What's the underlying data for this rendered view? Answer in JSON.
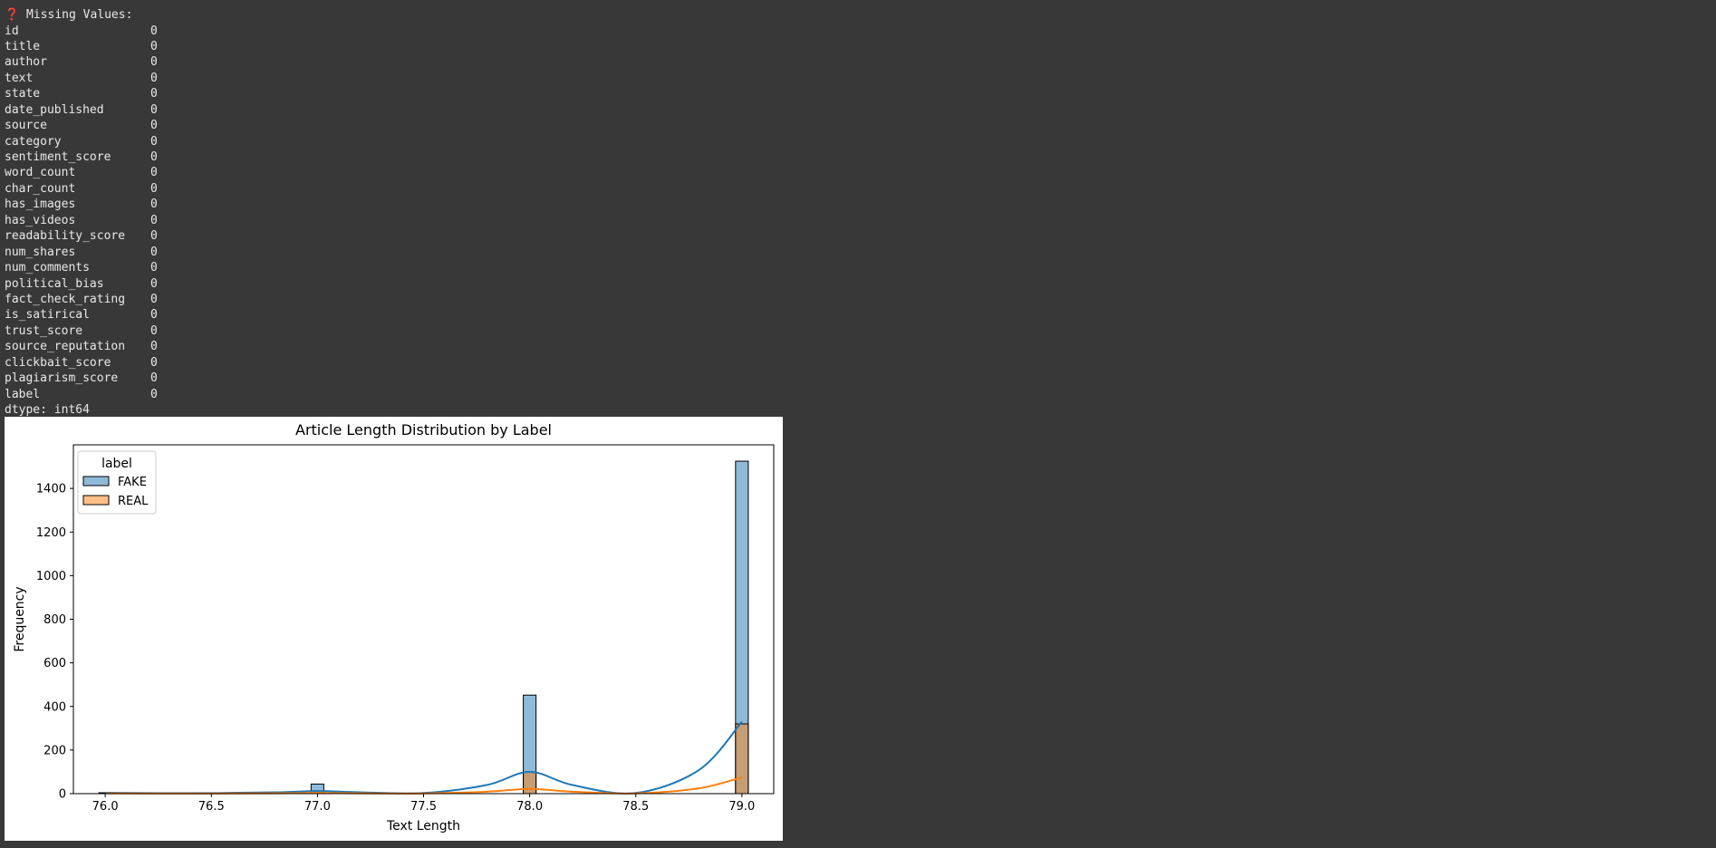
{
  "output": {
    "icon_glyph": "❓",
    "heading": "Missing Values:",
    "rows": [
      {
        "name": "id",
        "value": "0"
      },
      {
        "name": "title",
        "value": "0"
      },
      {
        "name": "author",
        "value": "0"
      },
      {
        "name": "text",
        "value": "0"
      },
      {
        "name": "state",
        "value": "0"
      },
      {
        "name": "date_published",
        "value": "0"
      },
      {
        "name": "source",
        "value": "0"
      },
      {
        "name": "category",
        "value": "0"
      },
      {
        "name": "sentiment_score",
        "value": "0"
      },
      {
        "name": "word_count",
        "value": "0"
      },
      {
        "name": "char_count",
        "value": "0"
      },
      {
        "name": "has_images",
        "value": "0"
      },
      {
        "name": "has_videos",
        "value": "0"
      },
      {
        "name": "readability_score",
        "value": "0"
      },
      {
        "name": "num_shares",
        "value": "0"
      },
      {
        "name": "num_comments",
        "value": "0"
      },
      {
        "name": "political_bias",
        "value": "0"
      },
      {
        "name": "fact_check_rating",
        "value": "0"
      },
      {
        "name": "is_satirical",
        "value": "0"
      },
      {
        "name": "trust_score",
        "value": "0"
      },
      {
        "name": "source_reputation",
        "value": "0"
      },
      {
        "name": "clickbait_score",
        "value": "0"
      },
      {
        "name": "plagiarism_score",
        "value": "0"
      },
      {
        "name": "label",
        "value": "0"
      }
    ],
    "dtype": "dtype: int64"
  },
  "chart_data": {
    "type": "bar",
    "title": "Article Length Distribution by Label",
    "xlabel": "Text Length",
    "ylabel": "Frequency",
    "xlim": [
      75.85,
      79.15
    ],
    "ylim": [
      0,
      1600
    ],
    "xticks": [
      76.0,
      76.5,
      77.0,
      77.5,
      78.0,
      78.5,
      79.0
    ],
    "xtick_labels": [
      "76.0",
      "76.5",
      "77.0",
      "77.5",
      "78.0",
      "78.5",
      "79.0"
    ],
    "yticks": [
      0,
      200,
      400,
      600,
      800,
      1000,
      1200,
      1400
    ],
    "ytick_labels": [
      "0",
      "200",
      "400",
      "600",
      "800",
      "1000",
      "1200",
      "1400"
    ],
    "grid": false,
    "legend": {
      "title": "label",
      "placement": "upper-left"
    },
    "series": [
      {
        "name": "FAKE",
        "color": "#1f77b4",
        "x": [
          76.0,
          77.0,
          78.0,
          79.0
        ],
        "values": [
          4,
          44,
          452,
          1525
        ],
        "kde": [
          [
            76.0,
            4
          ],
          [
            76.4,
            2
          ],
          [
            76.8,
            6
          ],
          [
            77.0,
            12
          ],
          [
            77.2,
            6
          ],
          [
            77.5,
            3
          ],
          [
            77.8,
            40
          ],
          [
            78.0,
            100
          ],
          [
            78.2,
            40
          ],
          [
            78.5,
            3
          ],
          [
            78.8,
            110
          ],
          [
            79.0,
            330
          ]
        ]
      },
      {
        "name": "REAL",
        "color": "#ff7f0e",
        "x": [
          76.0,
          77.0,
          78.0,
          79.0
        ],
        "values": [
          3,
          10,
          100,
          320
        ],
        "kde": [
          [
            76.0,
            1
          ],
          [
            76.4,
            0.5
          ],
          [
            76.8,
            1.5
          ],
          [
            77.0,
            3
          ],
          [
            77.2,
            1.5
          ],
          [
            77.5,
            1
          ],
          [
            77.8,
            9
          ],
          [
            78.0,
            22
          ],
          [
            78.2,
            9
          ],
          [
            78.5,
            1
          ],
          [
            78.8,
            25
          ],
          [
            79.0,
            75
          ]
        ]
      }
    ]
  }
}
